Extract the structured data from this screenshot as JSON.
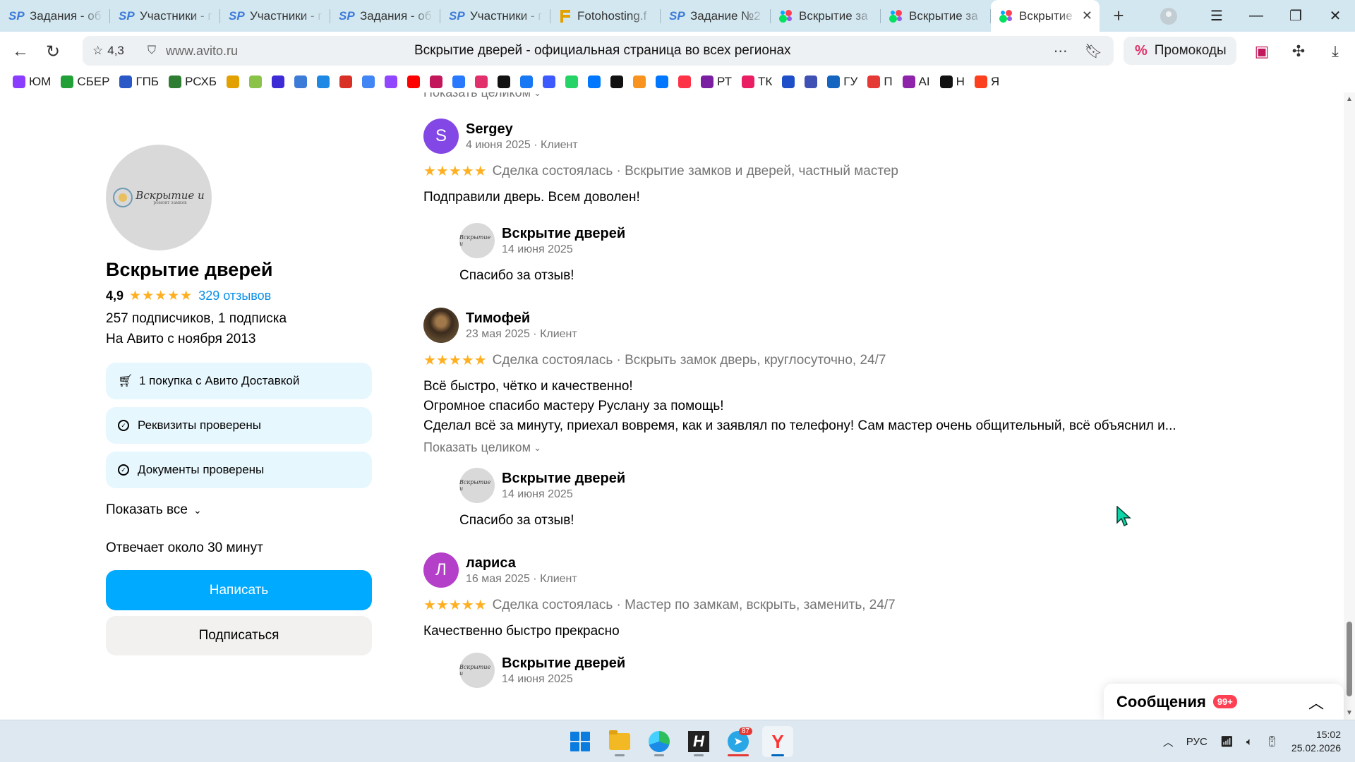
{
  "browser": {
    "tabs": [
      {
        "label": "Задания - об",
        "icon": "sp"
      },
      {
        "label": "Участники - г",
        "icon": "sp"
      },
      {
        "label": "Участники - г",
        "icon": "sp"
      },
      {
        "label": "Задания - об",
        "icon": "sp"
      },
      {
        "label": "Участники - г",
        "icon": "sp"
      },
      {
        "label": "Fotohosting.f",
        "icon": "f"
      },
      {
        "label": "Задание №2",
        "icon": "sp"
      },
      {
        "label": "Вскрытие за",
        "icon": "avito"
      },
      {
        "label": "Вскрытие за",
        "icon": "avito"
      },
      {
        "label": "Вскрытие",
        "icon": "avito",
        "active": true
      }
    ],
    "address": {
      "rating": "4,3",
      "url": "www.avito.ru",
      "page_title": "Вскрытие дверей - официальная страница во всех регионах"
    },
    "promo_label": "Промокоды",
    "bookmarks": [
      {
        "label": "ЮМ",
        "color": "#8b3dff"
      },
      {
        "label": "СБЕР",
        "color": "#21a038"
      },
      {
        "label": "ГПБ",
        "color": "#2a58c7"
      },
      {
        "label": "РСХБ",
        "color": "#2e7d32"
      },
      {
        "label": "",
        "color": "#e2a100"
      },
      {
        "label": "",
        "color": "#8bc34a"
      },
      {
        "label": "",
        "color": "#3d2bd6"
      },
      {
        "label": "",
        "color": "#3d7bd8"
      },
      {
        "label": "",
        "color": "#1e88e5"
      },
      {
        "label": "",
        "color": "#d93025"
      },
      {
        "label": "",
        "color": "#4285f4"
      },
      {
        "label": "",
        "color": "#9146ff"
      },
      {
        "label": "",
        "color": "#ff0000"
      },
      {
        "label": "",
        "color": "#c2185b"
      },
      {
        "label": "",
        "color": "#2979ff"
      },
      {
        "label": "",
        "color": "#e1306c"
      },
      {
        "label": "",
        "color": "#111111"
      },
      {
        "label": "",
        "color": "#1877f2"
      },
      {
        "label": "",
        "color": "#3d5afe"
      },
      {
        "label": "",
        "color": "#25d366"
      },
      {
        "label": "",
        "color": "#0077ff"
      },
      {
        "label": "",
        "color": "#111111"
      },
      {
        "label": "",
        "color": "#f7931e"
      },
      {
        "label": "",
        "color": "#0077ff"
      },
      {
        "label": "",
        "color": "#ff3347"
      },
      {
        "label": "РТ",
        "color": "#7b1fa2"
      },
      {
        "label": "ТК",
        "color": "#e91e63"
      },
      {
        "label": "",
        "color": "#1e4fc8"
      },
      {
        "label": "",
        "color": "#3f51b5"
      },
      {
        "label": "ГУ",
        "color": "#1565c0"
      },
      {
        "label": "П",
        "color": "#e53935"
      },
      {
        "label": "AI",
        "color": "#8e24aa"
      },
      {
        "label": "Н",
        "color": "#111111"
      },
      {
        "label": "Я",
        "color": "#fc3f1d"
      }
    ]
  },
  "profile": {
    "name": "Вскрытие дверей",
    "logo_text": "Вскрытие и",
    "logo_sub": "ремонт замков",
    "rating": "4,9",
    "stars": "★★★★★",
    "reviews_link": "329 отзывов",
    "subscribers": "257 подписчиков, 1 подписка",
    "since": "На Авито с ноября 2013",
    "badges": [
      "1 покупка с Авито Доставкой",
      "Реквизиты проверены",
      "Документы проверены"
    ],
    "show_all": "Показать все",
    "reply_time": "Отвечает около 30 минут",
    "write_button": "Написать",
    "subscribe_button": "Подписаться"
  },
  "reviews": {
    "show_full_label": "Показать целиком",
    "items": [
      {
        "author": "Sergey",
        "initial": "S",
        "avatar_color": "#8247e5",
        "date": "4 июня 2025 · Клиент",
        "stars": "★★★★★",
        "deal": "Сделка состоялась · Вскрытие замков и дверей, частный мастер",
        "text": [
          "Подправили дверь. Всем доволен!"
        ],
        "reply": {
          "author": "Вскрытие дверей",
          "date": "14 июня 2025",
          "text": "Спасибо за отзыв!"
        }
      },
      {
        "author": "Тимофей",
        "initial": "",
        "avatar_color": "#3b2a1c",
        "date": "23 мая 2025 · Клиент",
        "stars": "★★★★★",
        "deal": "Сделка состоялась · Вскрыть замок дверь, круглосуточно, 24/7",
        "text": [
          "Всё быстро, чётко и качественно!",
          "Огромное спасибо мастеру Руслану за помощь!",
          "Сделал всё за минуту, приехал вовремя, как и заявлял по телефону! Сам мастер очень общительный, всё объяснил и..."
        ],
        "reply": {
          "author": "Вскрытие дверей",
          "date": "14 июня 2025",
          "text": "Спасибо за отзыв!"
        }
      },
      {
        "author": "лариса",
        "initial": "Л",
        "avatar_color": "#b43fc9",
        "date": "16 мая 2025 · Клиент",
        "stars": "★★★★★",
        "deal": "Сделка состоялась · Мастер по замкам, вскрыть, заменить, 24/7",
        "text": [
          "Качественно быстро прекрасно"
        ],
        "reply": {
          "author": "Вскрытие дверей",
          "date": "14 июня 2025",
          "text": ""
        }
      }
    ]
  },
  "messages": {
    "title": "Сообщения",
    "count": "99+"
  },
  "taskbar": {
    "telegram_badge": "87",
    "language": "РУС",
    "time": "15:02",
    "date": "25.02.2026"
  }
}
